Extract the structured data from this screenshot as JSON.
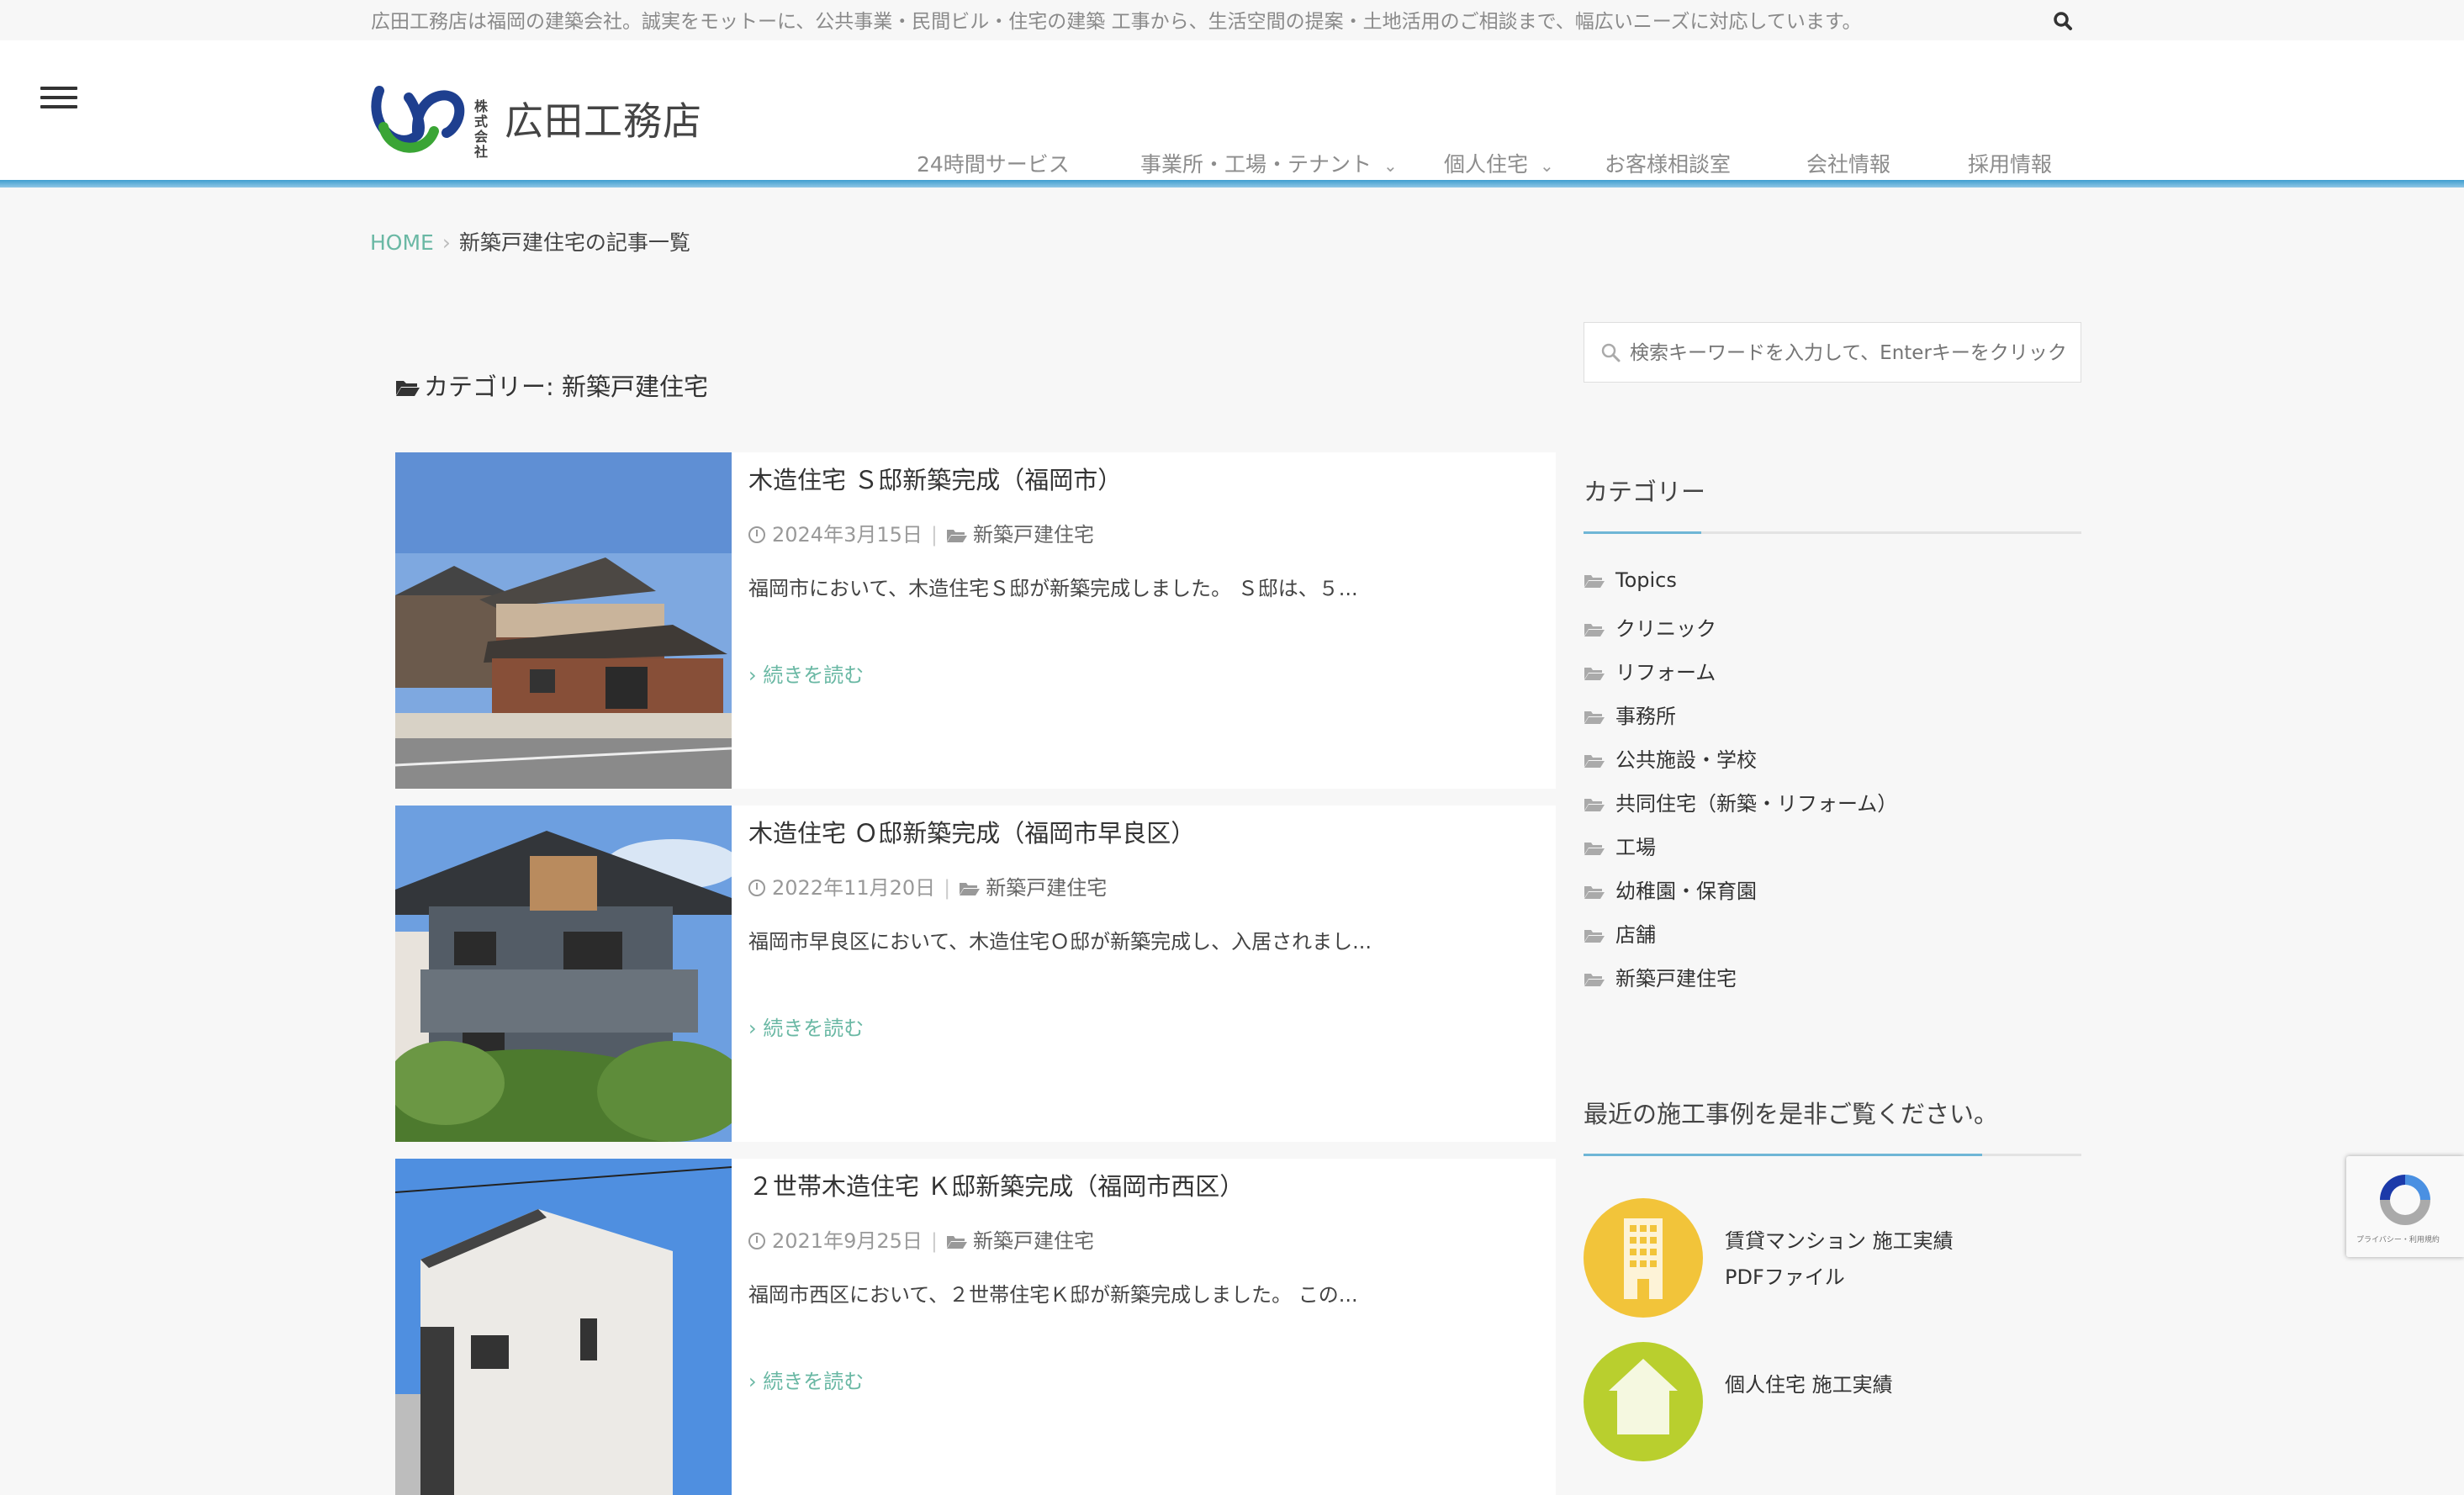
{
  "topbar": {
    "tagline": "広田工務店は福岡の建築会社。誠実をモットーに、公共事業・民間ビル・住宅の建築 工事から、生活空間の提案・土地活用のご相談まで、幅広いニーズに対応しています。"
  },
  "logo": {
    "small": "株式会社",
    "name": "広田工務店"
  },
  "nav": [
    {
      "label": "24時間サービス"
    },
    {
      "label": "事業所・工場・テナント"
    },
    {
      "label": "個人住宅"
    },
    {
      "label": "お客様相談室"
    },
    {
      "label": "会社情報"
    },
    {
      "label": "採用情報"
    }
  ],
  "breadcrumb": {
    "home": "HOME",
    "sep": "›",
    "current": "新築戸建住宅の記事一覧"
  },
  "category_heading": "カテゴリー: 新築戸建住宅",
  "posts": [
    {
      "title": "木造住宅 Ｓ邸新築完成（福岡市）",
      "date": "2024年3月15日",
      "category": "新築戸建住宅",
      "excerpt": "福岡市において、木造住宅Ｓ邸が新築完成しました。 Ｓ邸は、５...",
      "more": "続きを読む"
    },
    {
      "title": "木造住宅 Ｏ邸新築完成（福岡市早良区）",
      "date": "2022年11月20日",
      "category": "新築戸建住宅",
      "excerpt": "福岡市早良区において、木造住宅Ｏ邸が新築完成し、入居されまし...",
      "more": "続きを読む"
    },
    {
      "title": "２世帯木造住宅 Ｋ邸新築完成（福岡市西区）",
      "date": "2021年9月25日",
      "category": "新築戸建住宅",
      "excerpt": "福岡市西区において、２世帯住宅Ｋ邸が新築完成しました。 この...",
      "more": "続きを読む"
    }
  ],
  "sidebar": {
    "search_placeholder": "検索キーワードを入力して、Enterキーをクリックしてください",
    "categories_title": "カテゴリー",
    "categories": [
      "Topics",
      "クリニック",
      "リフォーム",
      "事務所",
      "公共施設・学校",
      "共同住宅（新築・リフォーム）",
      "工場",
      "幼稚園・保育園",
      "店舗",
      "新築戸建住宅"
    ],
    "works_title": "最近の施工事例を是非ご覧ください。",
    "works": [
      {
        "line1": "賃貸マンション 施工実績",
        "line2": "PDFファイル",
        "color": "#f2c43a"
      },
      {
        "line1": "個人住宅 施工実績",
        "line2": "",
        "color": "#b9cf2e"
      }
    ]
  },
  "recaptcha": {
    "text": "プライバシー・利用規約"
  },
  "colors": {
    "accent": "#6ab8a4",
    "header_line": "#3f9ed0"
  }
}
